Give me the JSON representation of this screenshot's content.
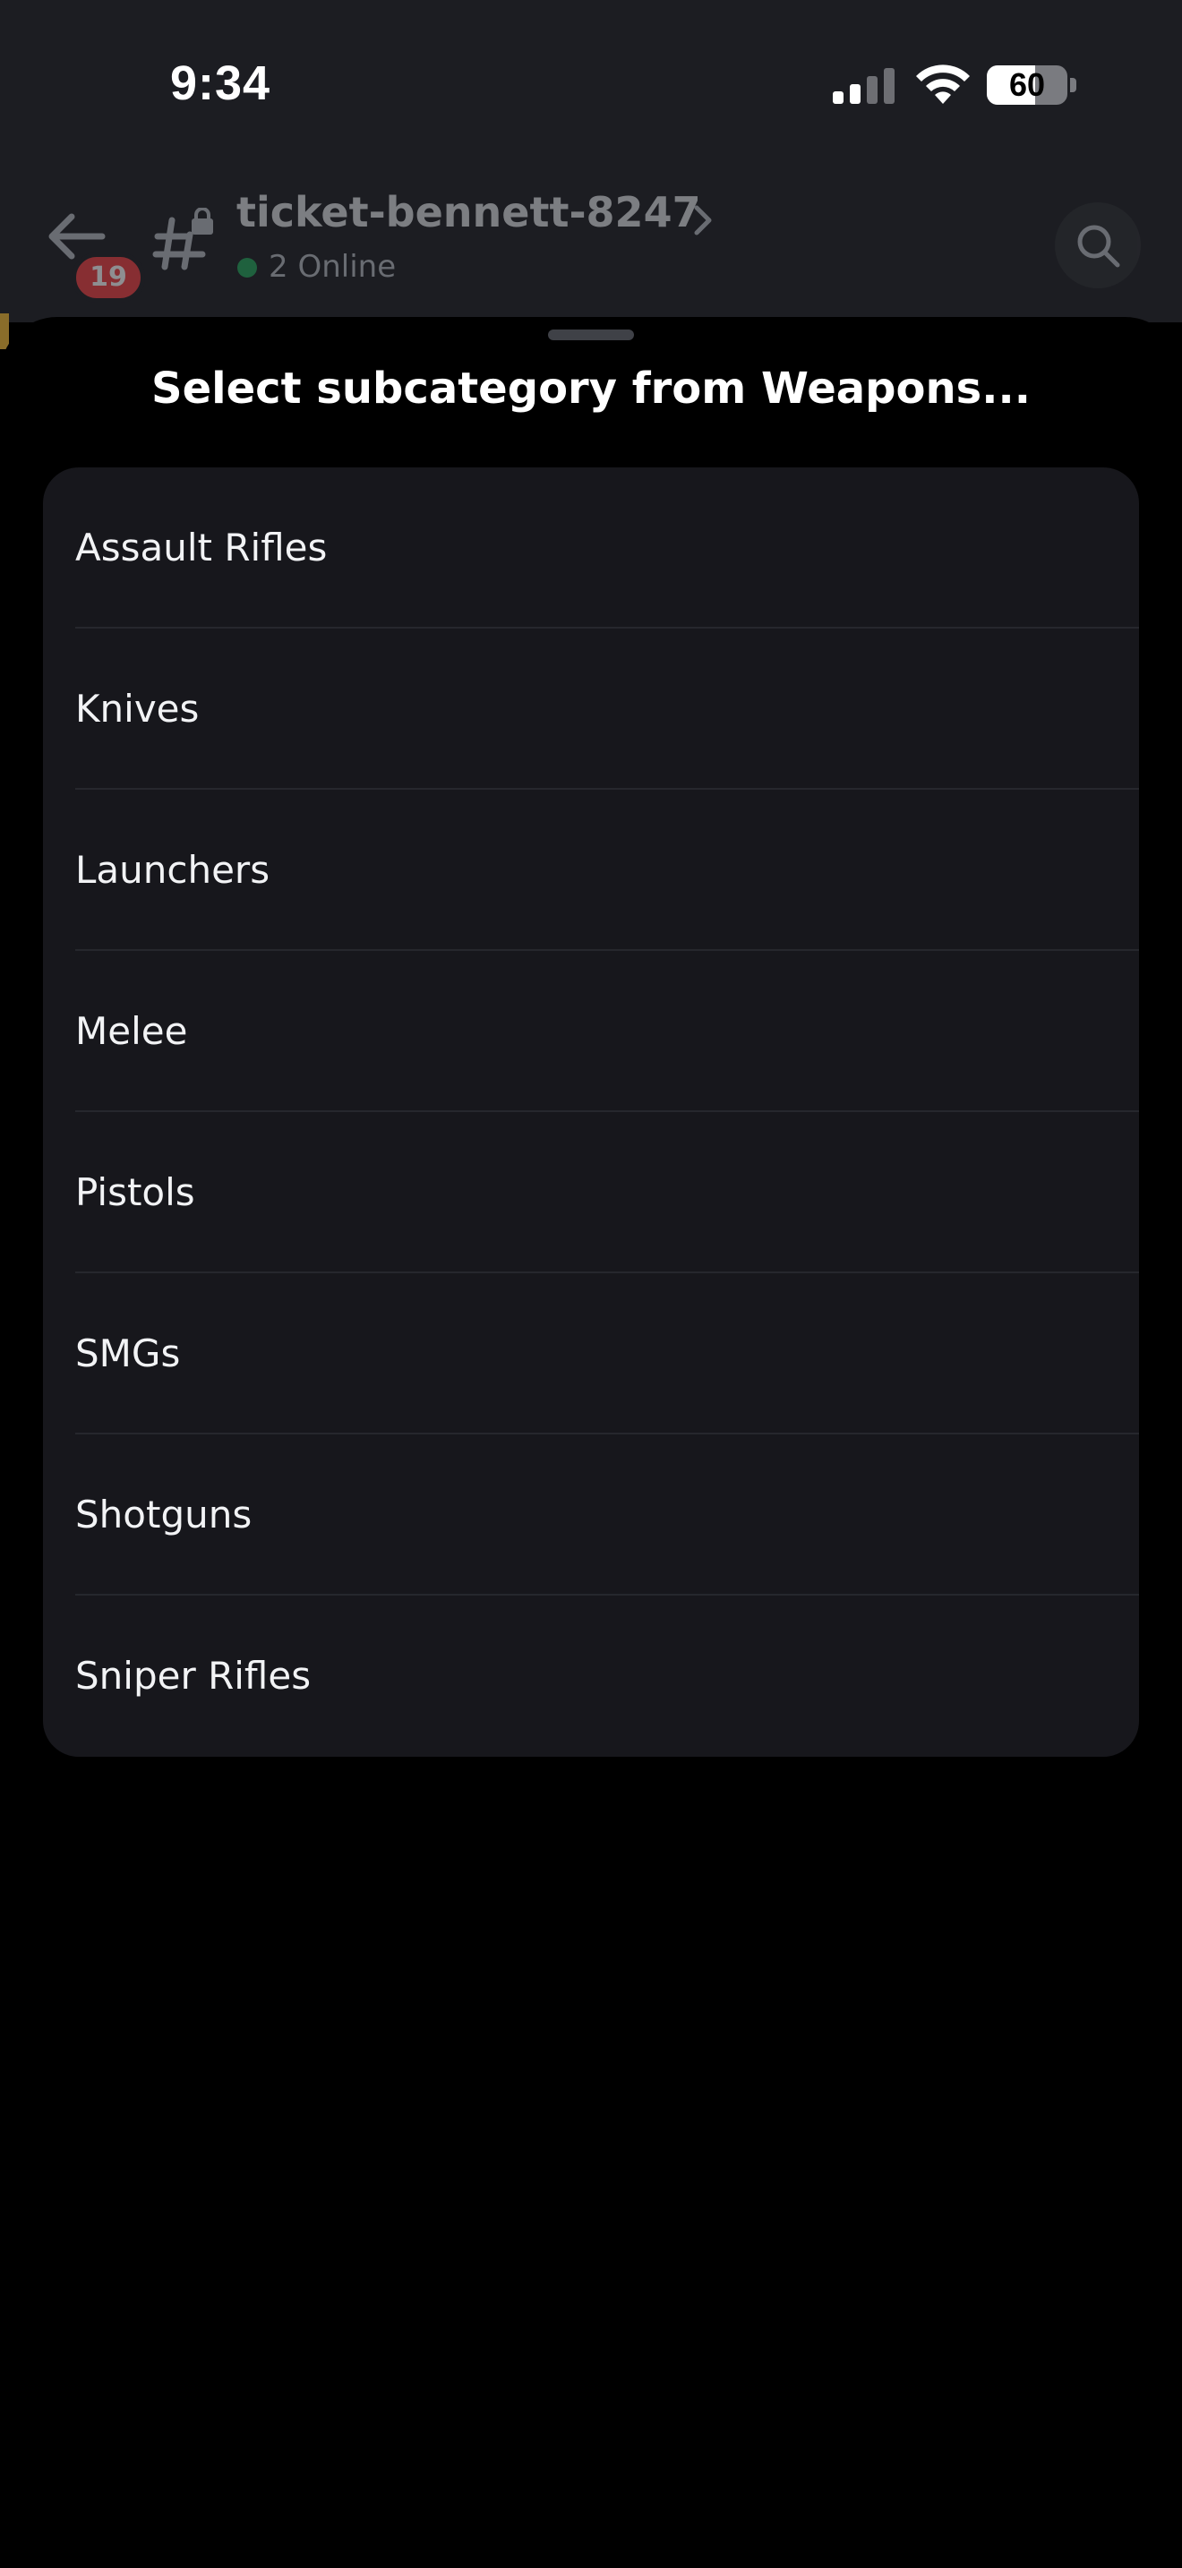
{
  "status_bar": {
    "time": "9:34",
    "battery_percent": "60",
    "battery_level": 0.6
  },
  "header": {
    "channel_name": "ticket-bennett-8247",
    "online_status": "2 Online",
    "unread_badge": "19"
  },
  "sheet": {
    "title": "Select subcategory from Weapons...",
    "options": [
      {
        "label": "Assault Rifles"
      },
      {
        "label": "Knives"
      },
      {
        "label": "Launchers"
      },
      {
        "label": "Melee"
      },
      {
        "label": "Pistols"
      },
      {
        "label": "SMGs"
      },
      {
        "label": "Shotguns"
      },
      {
        "label": "Sniper Rifles"
      }
    ]
  },
  "colors": {
    "sheet_background": "#000000",
    "card_background": "#17171c",
    "online_indicator": "#23a55a",
    "badge": "#f23f43"
  },
  "icons": [
    "signal-icon",
    "wifi-icon",
    "battery-icon",
    "back-arrow-icon",
    "channel-hash-lock-icon",
    "chevron-right-icon",
    "search-icon"
  ]
}
